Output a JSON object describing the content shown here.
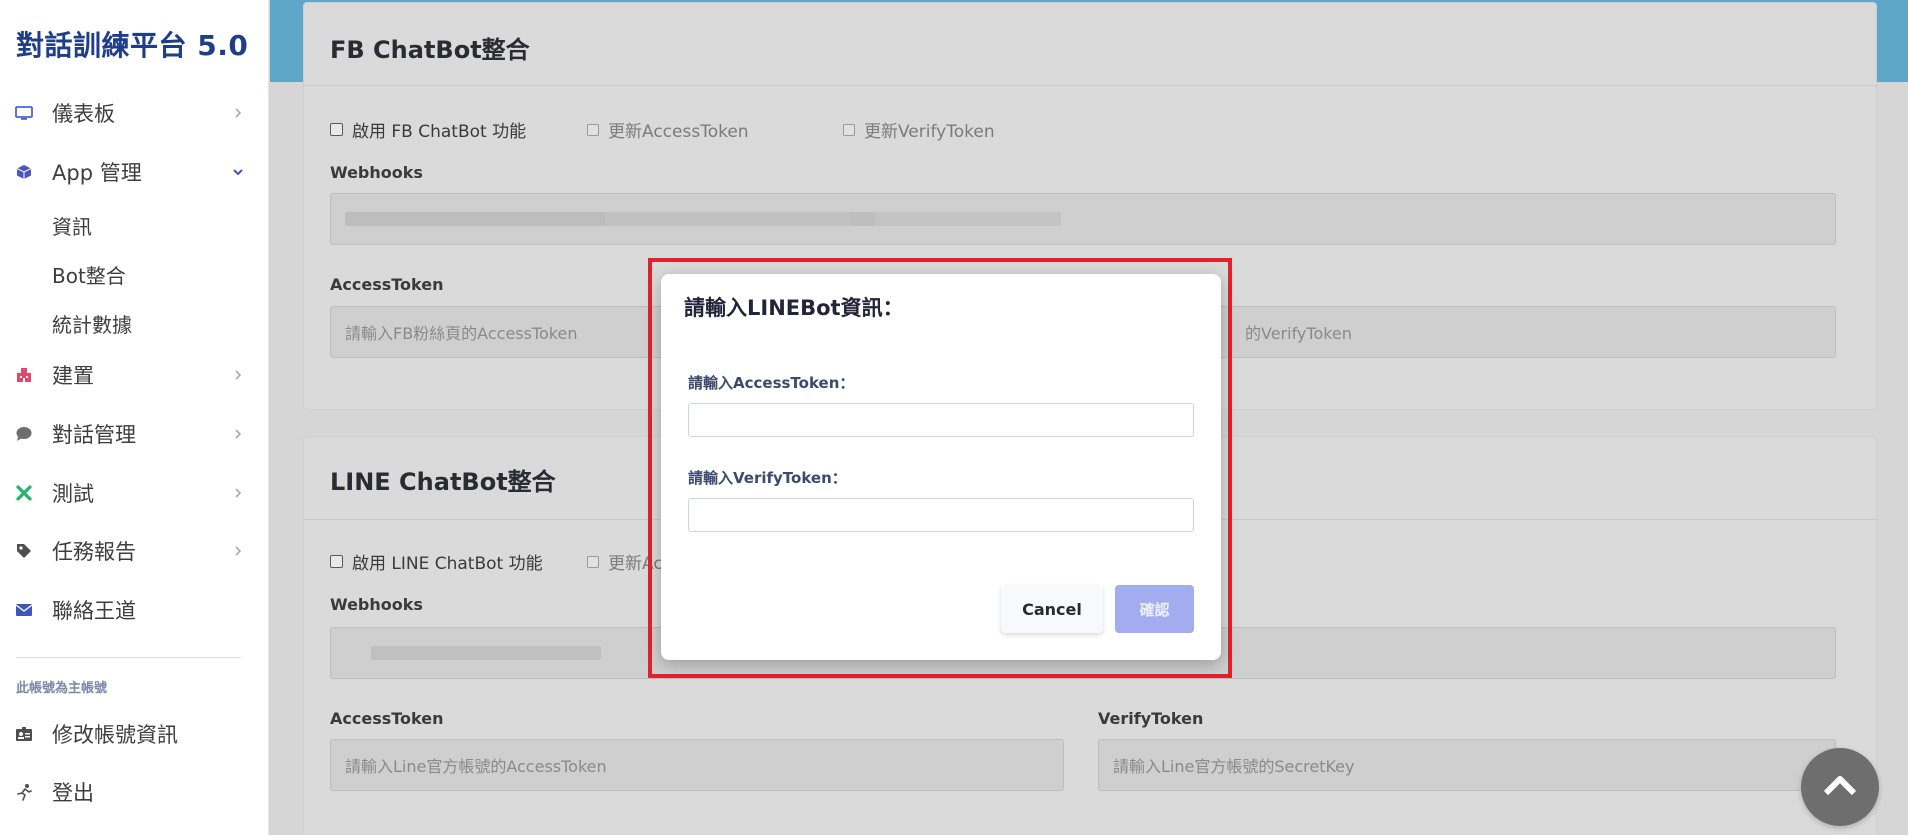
{
  "app": {
    "title": "對話訓練平台 5.0"
  },
  "sidebar": {
    "items": [
      {
        "label": "儀表板",
        "icon": "monitor-icon"
      },
      {
        "label": "App 管理",
        "icon": "cube-icon"
      },
      {
        "label": "建置",
        "icon": "building-icon"
      },
      {
        "label": "對話管理",
        "icon": "chat-bubble-icon"
      },
      {
        "label": "測試",
        "icon": "tools-icon"
      },
      {
        "label": "任務報告",
        "icon": "tag-icon"
      },
      {
        "label": "聯絡王道",
        "icon": "envelope-icon"
      }
    ],
    "app_sub_items": [
      "資訊",
      "Bot整合",
      "統計數據"
    ],
    "account_note": "此帳號為主帳號",
    "account_items": [
      {
        "label": "修改帳號資訊",
        "icon": "id-card-icon"
      },
      {
        "label": "登出",
        "icon": "running-icon"
      }
    ]
  },
  "fb": {
    "title": "FB ChatBot整合",
    "enable_label": "啟用 FB ChatBot 功能",
    "update_access_label": "更新AccessToken",
    "update_verify_label": "更新VerifyToken",
    "webhooks_label": "Webhooks",
    "access_label": "AccessToken",
    "access_placeholder": "請輸入FB粉絲頁的AccessToken",
    "verify_placeholder_tail": "的VerifyToken"
  },
  "line": {
    "title": "LINE ChatBot整合",
    "enable_label": "啟用 LINE ChatBot 功能",
    "update_access_partial": "更新Ac",
    "webhooks_label": "Webhooks",
    "access_label": "AccessToken",
    "verify_label": "VerifyToken",
    "access_placeholder": "請輸入Line官方帳號的AccessToken",
    "verify_placeholder": "請輸入Line官方帳號的SecretKey"
  },
  "modal": {
    "title": "請輸入LINEBot資訊：",
    "access_label": "請輸入AccessToken：",
    "verify_label": "請輸入VerifyToken：",
    "access_value": "",
    "verify_value": "",
    "cancel_label": "Cancel",
    "confirm_label": "確認"
  },
  "colors": {
    "brand": "#1f3e8a",
    "accent_band": "#5fa7c9",
    "highlight": "#e3212b",
    "confirm": "#a3acef"
  }
}
